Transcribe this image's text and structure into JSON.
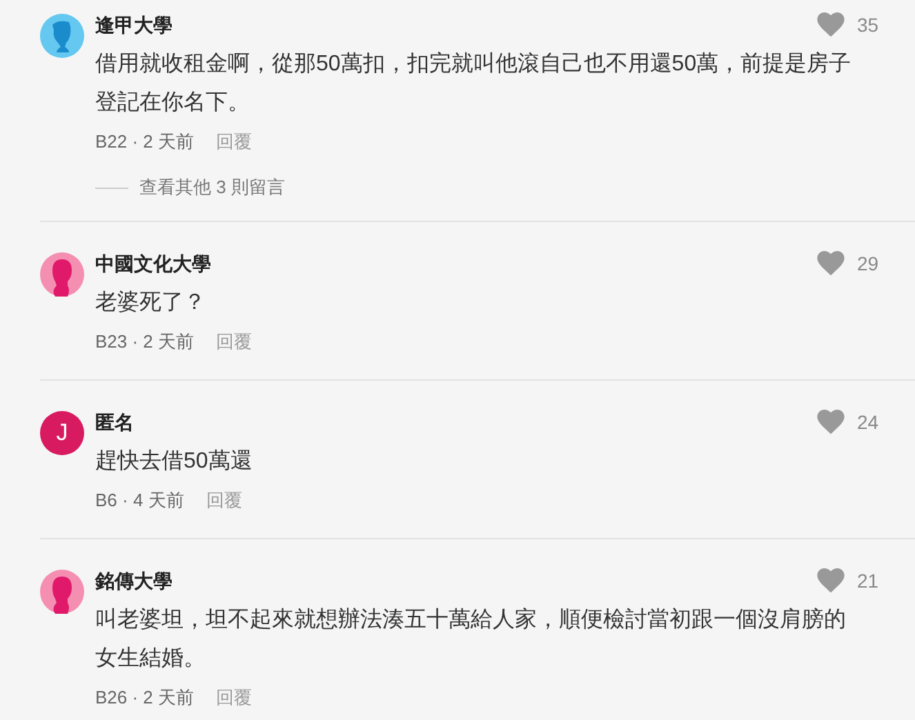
{
  "comments": [
    {
      "avatar": {
        "kind": "male",
        "color": "#64c8f0"
      },
      "name": "逢甲大學",
      "text": "借用就收租金啊，從那50萬扣，扣完就叫他滾自己也不用還50萬，前提是房子登記在你名下。",
      "meta": "B22 · 2 天前",
      "reply": "回覆",
      "likes": "35",
      "more_replies": "查看其他 3 則留言"
    },
    {
      "avatar": {
        "kind": "female",
        "color": "#f48fb1"
      },
      "name": "中國文化大學",
      "text": "老婆死了？",
      "meta": "B23 · 2 天前",
      "reply": "回覆",
      "likes": "29"
    },
    {
      "avatar": {
        "kind": "letter",
        "color": "#d81b60",
        "letter": "J"
      },
      "name": "匿名",
      "text": "趕快去借50萬還",
      "meta": "B6 · 4 天前",
      "reply": "回覆",
      "likes": "24"
    },
    {
      "avatar": {
        "kind": "female",
        "color": "#f48fb1"
      },
      "name": "銘傳大學",
      "text": "叫老婆坦，坦不起來就想辦法湊五十萬給人家，順便檢討當初跟一個沒肩膀的女生結婚。",
      "meta": "B26 · 2 天前",
      "reply": "回覆",
      "likes": "21"
    }
  ]
}
